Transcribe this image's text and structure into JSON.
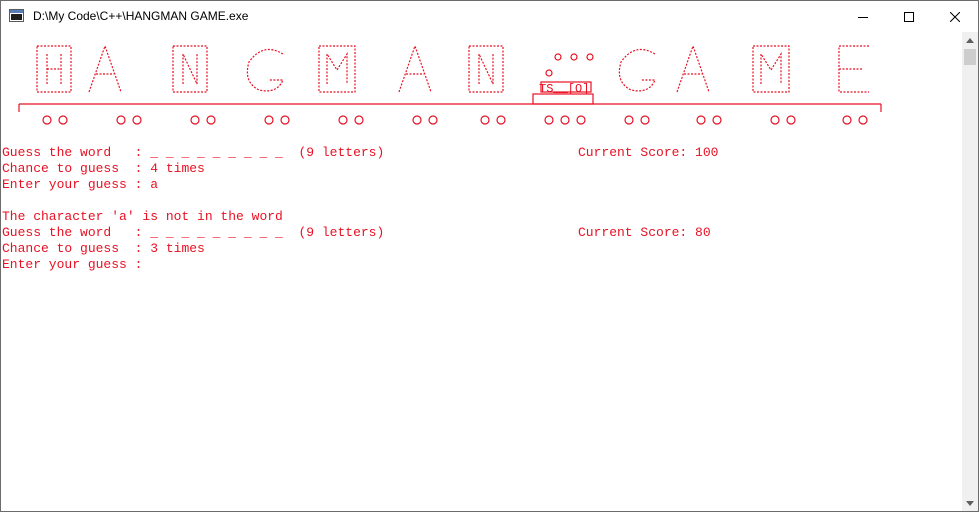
{
  "window": {
    "title": "D:\\My Code\\C++\\HANGMAN GAME.exe",
    "controls": [
      "minimize-icon",
      "maximize-icon",
      "close-icon"
    ]
  },
  "colors": {
    "console_text": "#e81123",
    "console_bg": "#ffffff"
  },
  "banner": {
    "text": "HANGMAN GAME",
    "style": "ASCII-art train of red letters with dashed outlines and wheels",
    "caption": "TS__[O]"
  },
  "rounds": [
    {
      "guess_label": "Guess the word",
      "word_mask": "_ _ _ _ _ _ _ _ _",
      "letter_count": "(9 letters)",
      "score": "Current Score: 100",
      "chance_label": "Chance to guess",
      "chance_value": "4 times",
      "input_label": "Enter your guess",
      "input_value": "a"
    },
    {
      "message": "The character 'a' is not in the word",
      "guess_label": "Guess the word",
      "word_mask": "_ _ _ _ _ _ _ _ _",
      "letter_count": "(9 letters)",
      "score": "Current Score: 80",
      "chance_label": "Chance to guess",
      "chance_value": "3 times",
      "input_label": "Enter your guess",
      "input_value": ""
    }
  ]
}
